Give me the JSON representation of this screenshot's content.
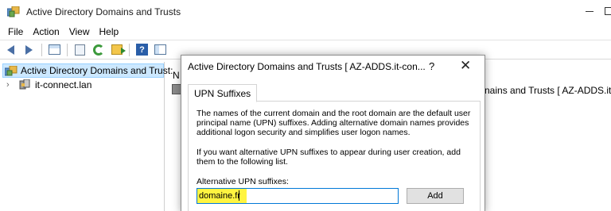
{
  "window": {
    "title": "Active Directory Domains and Trusts"
  },
  "menubar": {
    "items": [
      "File",
      "Action",
      "View",
      "Help"
    ]
  },
  "toolbar": {
    "buttons": [
      "back-icon",
      "forward-icon",
      "show-hide-console-tree-icon",
      "properties-icon",
      "refresh-icon",
      "export-list-icon",
      "help-icon",
      "show-hide-action-pane-icon"
    ]
  },
  "tree": {
    "root_label": "Active Directory Domains and Trust:",
    "child_label": "it-connect.lan"
  },
  "right_pane": {
    "column_header": "N",
    "overflow_text": "nains and Trusts [ AZ-ADDS.it-con"
  },
  "dialog": {
    "title": "Active Directory Domains and Trusts [ AZ-ADDS.it-con...",
    "help_label": "?",
    "close_label": "✕",
    "tab_label": "UPN Suffixes",
    "paragraph1": "The names of the current domain and the root domain are the default user principal name (UPN) suffixes. Adding alternative domain names provides additional logon security and simplifies user logon names.",
    "paragraph2": "If you want alternative UPN suffixes to appear during user creation, add them to the following list.",
    "alt_label": "Alternative UPN suffixes:",
    "alt_value": "domaine.fr",
    "add_label": "Add"
  },
  "colors": {
    "selection": "#cce8ff",
    "highlight": "#fff21f",
    "focus_border": "#0078d7"
  }
}
